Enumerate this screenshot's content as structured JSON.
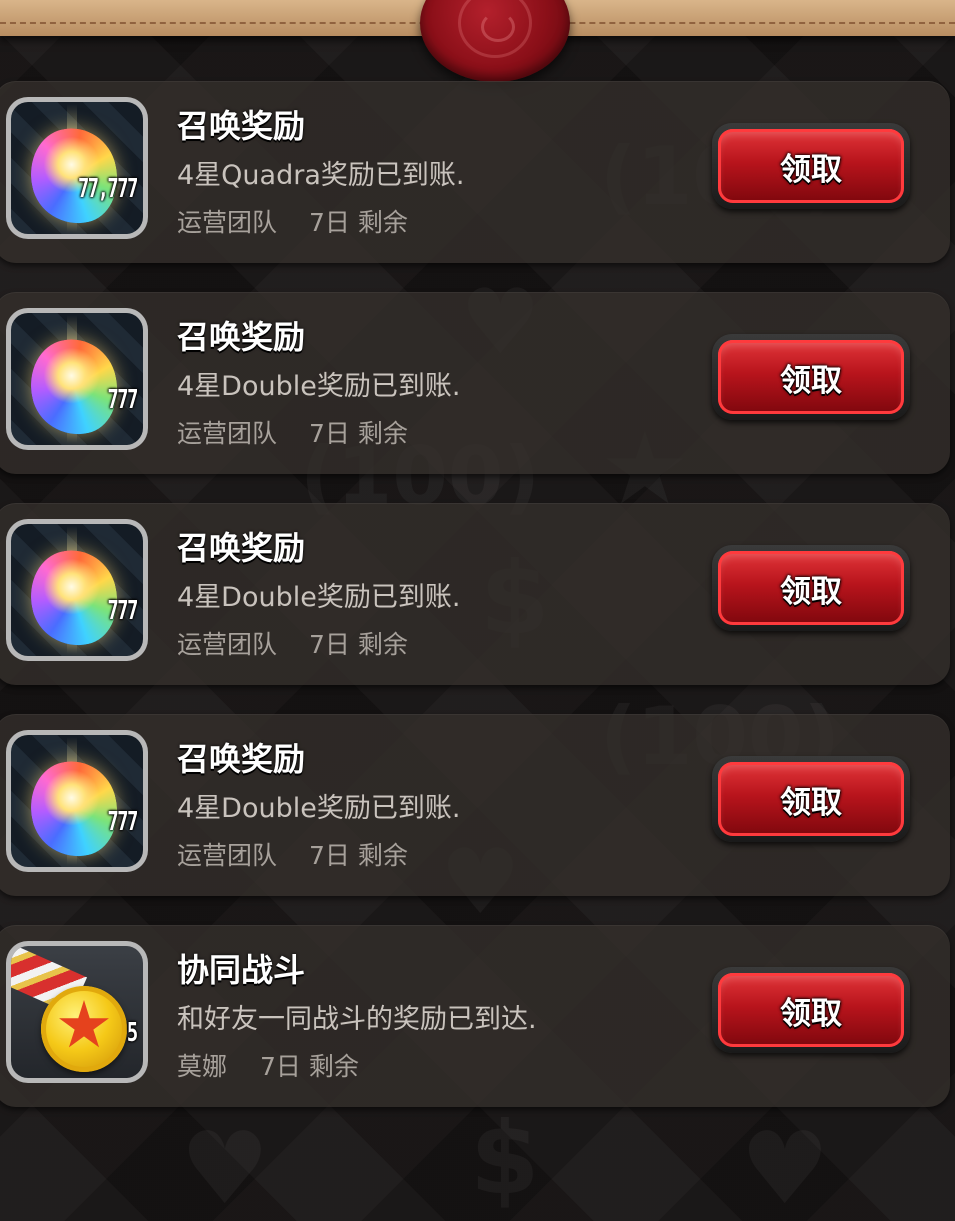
{
  "inbox": {
    "items": [
      {
        "title": "召唤奖励",
        "message": "4星Quadra奖励已到账.",
        "sender": "运营团队",
        "remaining": "7日 剩余",
        "icon": "rainbow-gem-icon",
        "quantity": "77,777",
        "button_label": "领取"
      },
      {
        "title": "召唤奖励",
        "message": "4星Double奖励已到账.",
        "sender": "运营团队",
        "remaining": "7日 剩余",
        "icon": "rainbow-gem-icon",
        "quantity": "777",
        "button_label": "领取"
      },
      {
        "title": "召唤奖励",
        "message": "4星Double奖励已到账.",
        "sender": "运营团队",
        "remaining": "7日 剩余",
        "icon": "rainbow-gem-icon",
        "quantity": "777",
        "button_label": "领取"
      },
      {
        "title": "召唤奖励",
        "message": "4星Double奖励已到账.",
        "sender": "运营团队",
        "remaining": "7日 剩余",
        "icon": "rainbow-gem-icon",
        "quantity": "777",
        "button_label": "领取"
      },
      {
        "title": "协同战斗",
        "message": "和好友一同战斗的奖励已到达.",
        "sender": "莫娜",
        "remaining": "7日 剩余",
        "icon": "gold-medal-icon",
        "quantity": "5",
        "button_label": "领取"
      }
    ]
  },
  "colors": {
    "button_red": "#b8141c",
    "background": "#171414",
    "band": "#c9a173",
    "seal": "#8a0f18"
  }
}
